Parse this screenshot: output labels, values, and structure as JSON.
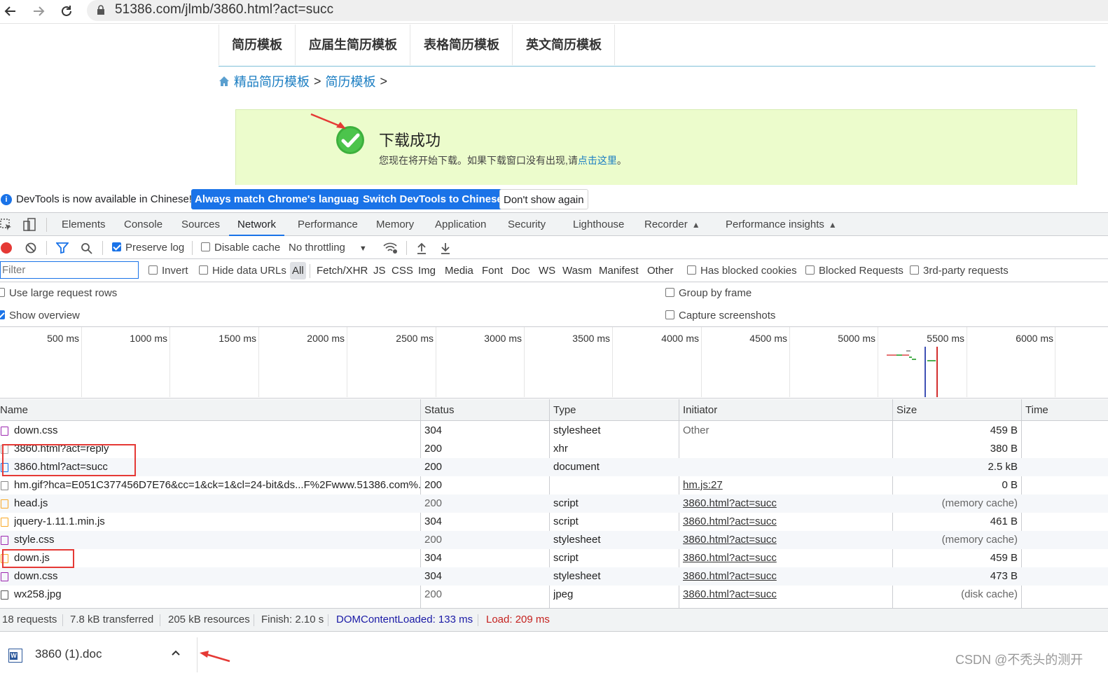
{
  "browser": {
    "url": "51386.com/jlmb/3860.html?act=succ"
  },
  "page": {
    "topnav": [
      "简历模板",
      "应届生简历模板",
      "表格简历模板",
      "英文简历模板"
    ],
    "breadcrumb": {
      "items": [
        "精品简历模板",
        "简历模板"
      ],
      "separator": ">"
    },
    "success": {
      "title": "下载成功",
      "message_prefix": "您现在将开始下载。如果下载窗口没有出现,请",
      "link": "点击这里",
      "message_suffix": "。"
    }
  },
  "devtools": {
    "infobar": {
      "text": "DevTools is now available in Chinese!",
      "btn_match": "Always match Chrome's language",
      "btn_switch": "Switch DevTools to Chinese",
      "btn_dont_show": "Don't show again"
    },
    "tabs": [
      "Elements",
      "Console",
      "Sources",
      "Network",
      "Performance",
      "Memory",
      "Application",
      "Security",
      "Lighthouse",
      "Recorder",
      "Performance insights"
    ],
    "active_tab": "Network",
    "toolbar": {
      "preserve_log": "Preserve log",
      "disable_cache": "Disable cache",
      "throttling": "No throttling"
    },
    "filter": {
      "placeholder": "Filter",
      "invert": "Invert",
      "hide_data_urls": "Hide data URLs",
      "types": [
        "All",
        "Fetch/XHR",
        "JS",
        "CSS",
        "Img",
        "Media",
        "Font",
        "Doc",
        "WS",
        "Wasm",
        "Manifest",
        "Other"
      ],
      "has_blocked_cookies": "Has blocked cookies",
      "blocked_requests": "Blocked Requests",
      "third_party": "3rd-party requests"
    },
    "settings": {
      "large_rows": "Use large request rows",
      "show_overview": "Show overview",
      "group_by_frame": "Group by frame",
      "capture_screenshots": "Capture screenshots"
    },
    "overview_ticks": [
      "500 ms",
      "1000 ms",
      "1500 ms",
      "2000 ms",
      "2500 ms",
      "3000 ms",
      "3500 ms",
      "4000 ms",
      "4500 ms",
      "5000 ms",
      "5500 ms",
      "6000 ms"
    ],
    "columns": [
      "Name",
      "Status",
      "Type",
      "Initiator",
      "Size",
      "Time"
    ],
    "rows": [
      {
        "name": "down.css",
        "status": "304",
        "type": "stylesheet",
        "initiator": "Other",
        "size": "459 B"
      },
      {
        "name": "3860.html?act=reply",
        "status": "200",
        "type": "xhr",
        "initiator": "",
        "size": "380 B"
      },
      {
        "name": "3860.html?act=succ",
        "status": "200",
        "type": "document",
        "initiator": "",
        "size": "2.5 kB"
      },
      {
        "name": "hm.gif?hca=E051C377456D7E76&cc=1&ck=1&cl=24-bit&ds...F%2Fwww.51386.com%...",
        "status": "200",
        "type": "",
        "initiator": "hm.js:27",
        "size": "0 B"
      },
      {
        "name": "head.js",
        "status": "200",
        "type": "script",
        "initiator": "3860.html?act=succ",
        "size": "(memory cache)"
      },
      {
        "name": "jquery-1.11.1.min.js",
        "status": "304",
        "type": "script",
        "initiator": "3860.html?act=succ",
        "size": "461 B"
      },
      {
        "name": "style.css",
        "status": "200",
        "type": "stylesheet",
        "initiator": "3860.html?act=succ",
        "size": "(memory cache)"
      },
      {
        "name": "down.js",
        "status": "304",
        "type": "script",
        "initiator": "3860.html?act=succ",
        "size": "459 B"
      },
      {
        "name": "down.css",
        "status": "304",
        "type": "stylesheet",
        "initiator": "3860.html?act=succ",
        "size": "473 B"
      },
      {
        "name": "wx258.jpg",
        "status": "200",
        "type": "jpeg",
        "initiator": "3860.html?act=succ",
        "size": "(disk cache)"
      }
    ],
    "status_bar": {
      "requests": "18 requests",
      "transferred": "7.8 kB transferred",
      "resources": "205 kB resources",
      "finish": "Finish: 2.10 s",
      "dom_loaded": "DOMContentLoaded: 133 ms",
      "load": "Load: 209 ms"
    }
  },
  "download": {
    "filename": "3860 (1).doc"
  },
  "watermark": "CSDN @不秃头的测开",
  "colors": {
    "accent": "#1a73e8",
    "success_bg": "#ecfccc",
    "link": "#1a7dc2",
    "dom_loaded": "#1a1aa6",
    "load": "#c5221f",
    "annotation": "#e53935"
  }
}
